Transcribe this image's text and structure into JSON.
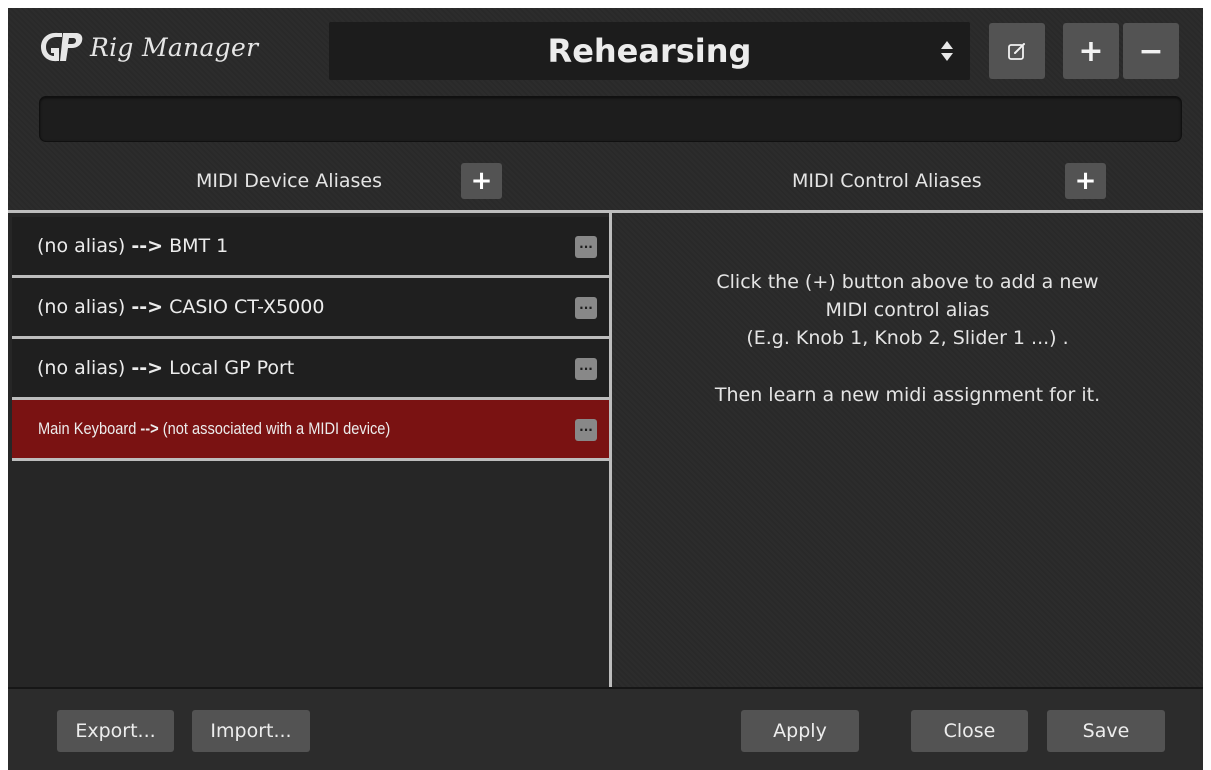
{
  "app": {
    "title": "Rig Manager"
  },
  "header": {
    "rig_name": "Rehearsing",
    "add_label": "+",
    "remove_label": "−"
  },
  "device_aliases": {
    "title": "MIDI Device Aliases",
    "add_label": "+",
    "items": [
      {
        "alias": "(no alias)",
        "arrow": "-->",
        "device": "BMT 1",
        "selected": false
      },
      {
        "alias": "(no alias)",
        "arrow": "-->",
        "device": "CASIO CT-X5000",
        "selected": false
      },
      {
        "alias": "(no alias)",
        "arrow": "-->",
        "device": "Local GP Port",
        "selected": false
      },
      {
        "alias": "Main Keyboard",
        "arrow": "-->",
        "device": "(not associated with a MIDI device)",
        "selected": true
      }
    ],
    "more_label": "···"
  },
  "control_aliases": {
    "title": "MIDI Control Aliases",
    "add_label": "+",
    "help_line_1": "Click the (+) button above to add a new",
    "help_line_2": "MIDI control alias",
    "help_line_3": "(E.g. Knob 1, Knob 2, Slider 1 ...) .",
    "help_line_4": "Then learn a new midi assignment for it."
  },
  "footer": {
    "export_label": "Export...",
    "import_label": "Import...",
    "apply_label": "Apply",
    "close_label": "Close",
    "save_label": "Save"
  },
  "colors": {
    "background": "#2a2a2a",
    "button": "#535353",
    "selected_row": "#7a1212",
    "divider": "#bdbdbd"
  },
  "icons": {
    "logo": "gp-logo-icon",
    "selector": "up-down-arrows-icon",
    "rename": "edit-icon",
    "more": "ellipsis-icon"
  }
}
